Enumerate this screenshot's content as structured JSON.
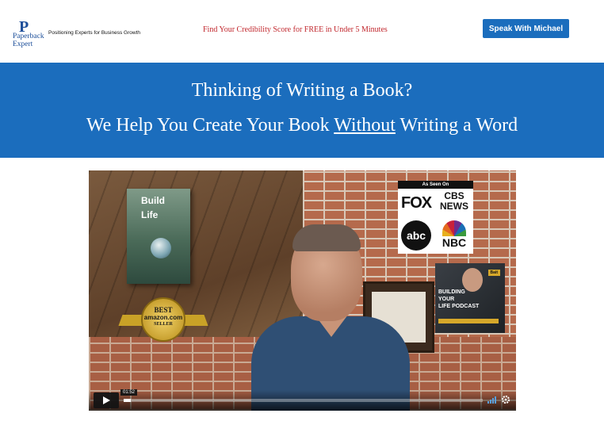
{
  "header": {
    "logo": {
      "line1": "Paperback",
      "line2": "Expert"
    },
    "tagline": "Positioning Experts for Business Growth",
    "promo": "Find Your Credibility Score for FREE in Under 5 Minutes",
    "cta_label": "Speak With Michael"
  },
  "hero": {
    "line1": "Thinking of Writing a Book?",
    "line2_before": "We Help You Create Your Book ",
    "line2_underlined": "Without",
    "line2_after": " Writing a Word"
  },
  "video": {
    "book": {
      "line1": "Build",
      "line2": "Life"
    },
    "seal": {
      "best": "BEST",
      "brand": "amazon.com",
      "seller": "SELLER"
    },
    "as_seen_on": {
      "heading": "As Seen On",
      "fox": "FOX",
      "cbs_line1": "CBS",
      "cbs_line2": "NEWS",
      "abc": "abc",
      "nbc": "NBC"
    },
    "podcast": {
      "badge": "Bait",
      "title_line1": "BUILDING",
      "title_line2": "YOUR",
      "title_line3": "LIFE PODCAST"
    },
    "controls": {
      "timecode": "01:52",
      "progress": 0.02,
      "play_icon": "play-icon",
      "volume_icon": "volume-icon",
      "settings_icon": "gear-icon"
    }
  },
  "colors": {
    "brand_blue": "#1b6dbd",
    "promo_red": "#c1272d",
    "logo_blue": "#1d4f9a"
  }
}
